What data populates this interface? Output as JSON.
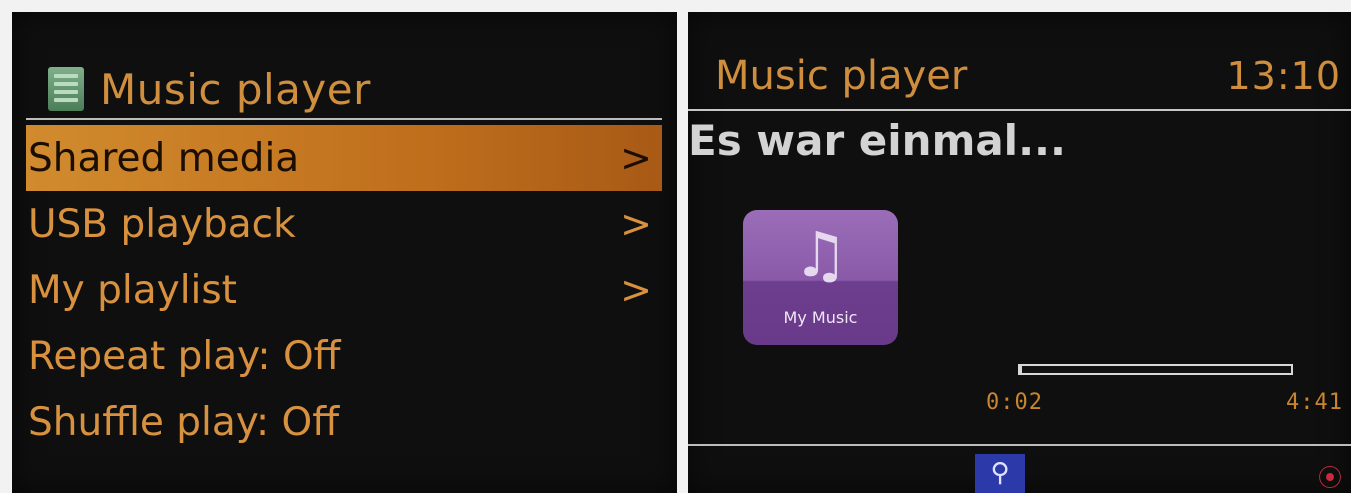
{
  "menu_screen": {
    "title": "Music player",
    "items": [
      {
        "label": "Shared media",
        "arrow": ">",
        "selected": true
      },
      {
        "label": "USB playback",
        "arrow": ">",
        "selected": false
      },
      {
        "label": "My playlist",
        "arrow": ">",
        "selected": false
      },
      {
        "label": "Repeat play: Off",
        "arrow": "",
        "selected": false
      },
      {
        "label": "Shuffle play: Off",
        "arrow": "",
        "selected": false
      }
    ],
    "icon": "list-menu-icon"
  },
  "now_playing_screen": {
    "title": "Music player",
    "clock": "13:10",
    "track": "Es war einmal...",
    "source_tile": {
      "label": "My Music",
      "icon": "music-note-icon",
      "glyph": "♫"
    },
    "elapsed": "0:02",
    "total": "4:41",
    "progress_fraction": 0.0071,
    "status": {
      "usb_icon": "usb-icon",
      "usb_glyph": "⚲",
      "wifi_icon": "wifi-signal-icon",
      "wifi_glyph": "⦿"
    }
  },
  "colors": {
    "accent_orange": "#d08f3e",
    "selection_orange": "#c0701c",
    "track_text": "#d3d3d3",
    "tile_purple": "#8a5aa9",
    "usb_blue": "#2c39a8",
    "wifi_red": "#c92a3e"
  }
}
